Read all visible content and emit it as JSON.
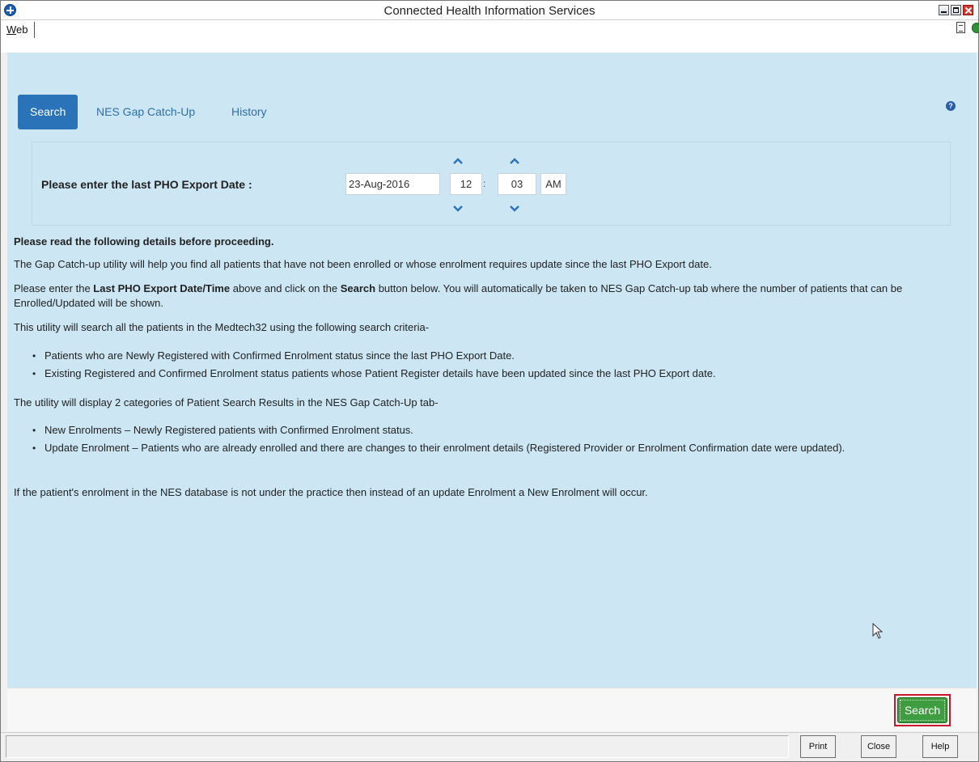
{
  "window": {
    "title": "Connected Health Information Services"
  },
  "menu": {
    "web_tab": "Web"
  },
  "tabs": [
    {
      "label": "Search",
      "active": true
    },
    {
      "label": "NES Gap Catch-Up",
      "active": false
    },
    {
      "label": "History",
      "active": false
    }
  ],
  "export": {
    "label": "Please enter the last PHO Export Date :",
    "date": "23-Aug-2016",
    "hour": "12",
    "minute": "03",
    "ampm": "AM"
  },
  "info": {
    "heading": "Please read the following details before proceeding.",
    "p1": "The Gap Catch-up utility will help you find all patients that have not been enrolled or whose enrolment requires update since the last PHO Export date.",
    "p2_a": "Please enter the ",
    "p2_b": "Last PHO Export Date/Time",
    "p2_c": " above and click on the ",
    "p2_d": "Search",
    "p2_e": " button below. You will automatically be taken to NES Gap Catch-up tab where the number of patients that can be Enrolled/Updated will be shown.",
    "p3": "This utility will search all the patients in the Medtech32 using the following search criteria-",
    "criteria": [
      "Patients who are Newly Registered with Confirmed Enrolment status since the last PHO Export Date.",
      "Existing Registered and Confirmed Enrolment status patients whose Patient Register details have been updated since the last PHO Export date."
    ],
    "p4": "The utility will display 2 categories of Patient Search Results in the NES Gap Catch-Up tab-",
    "categories": [
      "New Enrolments – Newly Registered patients with Confirmed Enrolment status.",
      "Update Enrolment – Patients who are already enrolled and there are changes to their enrolment details (Registered Provider or Enrolment Confirmation date were updated)."
    ],
    "p5": "If the patient's enrolment in the NES database is not under the practice then instead of an update Enrolment a New Enrolment will occur."
  },
  "actions": {
    "search_label": "Search"
  },
  "footer": {
    "print_label": "Print",
    "close_label": "Close",
    "help_label": "Help"
  },
  "colors": {
    "panel_bg": "#cce6f4",
    "active_tab": "#2a73b8",
    "search_button": "#3e9d3f",
    "highlight_border": "#c8162c"
  },
  "icons": {
    "app": "app-logo-icon",
    "help": "question-circle-icon",
    "up": "chevron-up-icon",
    "down": "chevron-down-icon"
  }
}
